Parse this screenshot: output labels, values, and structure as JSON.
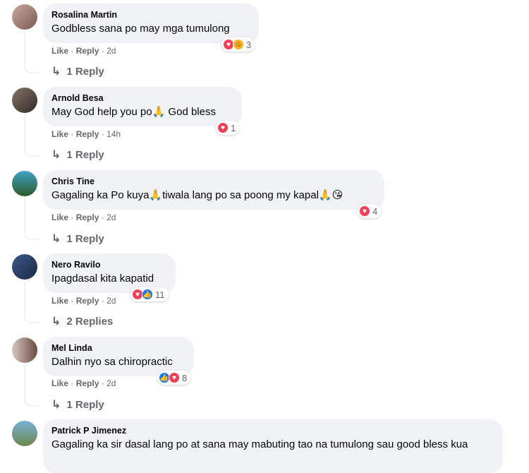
{
  "comments": [
    {
      "author": "Rosalina Martin",
      "text": "Godbless sana po may mga tumulong",
      "actions": {
        "like": "Like",
        "reply": "Reply",
        "sep": "·",
        "time": "2d"
      },
      "reactions": {
        "icons": [
          "love-icon",
          "haha-icon"
        ],
        "count": "3"
      },
      "replies_label": "1 Reply",
      "avatar_colors": [
        "#c9a9a0",
        "#7a5a50"
      ]
    },
    {
      "author": "Arnold Besa",
      "text": "May God help you po🙏 God bless",
      "actions": {
        "like": "Like",
        "reply": "Reply",
        "sep": "·",
        "time": "14h"
      },
      "reactions": {
        "icons": [
          "love-icon"
        ],
        "count": "1"
      },
      "replies_label": "1 Reply",
      "avatar_colors": [
        "#8a7468",
        "#2f2a28"
      ]
    },
    {
      "author": "Chris Tine",
      "text": "Gagaling ka Po kuya🙏tiwala lang po sa poong my kapal🙏😘",
      "actions": {
        "like": "Like",
        "reply": "Reply",
        "sep": "·",
        "time": "2d"
      },
      "reactions": {
        "icons": [
          "love-icon"
        ],
        "count": "4"
      },
      "replies_label": "1 Reply",
      "avatar_colors": [
        "#3fa3c4",
        "#2d5a2a"
      ]
    },
    {
      "author": "Nero Ravilo",
      "text": "Ipagdasal kita kapatid",
      "actions": {
        "like": "Like",
        "reply": "Reply",
        "sep": "·",
        "time": "2d"
      },
      "reactions": {
        "icons": [
          "love-icon",
          "like-icon"
        ],
        "count": "11"
      },
      "replies_label": "2 Replies",
      "avatar_colors": [
        "#3a5a8a",
        "#1c2840"
      ]
    },
    {
      "author": "Mel Linda",
      "text": "Dalhin nyo sa chiropractic",
      "actions": {
        "like": "Like",
        "reply": "Reply",
        "sep": "·",
        "time": "2d"
      },
      "reactions": {
        "icons": [
          "like-icon",
          "love-icon"
        ],
        "count": "8"
      },
      "replies_label": "1 Reply",
      "avatar_colors": [
        "#d8c8c0",
        "#6a4a40"
      ]
    },
    {
      "author": "Patrick P Jimenez",
      "text": "Gagaling ka sir dasal lang po at sana may mabuting tao na tumulong sau good bless kua",
      "avatar_colors": [
        "#7ab0d8",
        "#6a8a4a"
      ]
    }
  ],
  "colors": {
    "love": "#f33e58",
    "like": "#1877f2",
    "bubble": "#f0f2f5",
    "meta": "#65676b"
  }
}
